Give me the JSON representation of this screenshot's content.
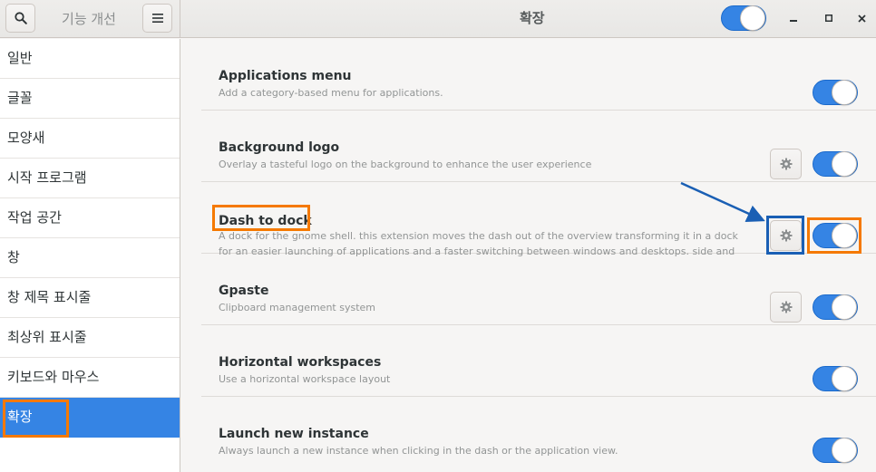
{
  "header": {
    "search_icon": "search-icon",
    "left_title": "기능 개선",
    "menu_icon": "hamburger-menu-icon",
    "title": "확장",
    "master_switch_on": true,
    "window_buttons": [
      "minimize-icon",
      "maximize-icon",
      "close-icon"
    ]
  },
  "sidebar": {
    "items": [
      {
        "label": "일반",
        "selected": false
      },
      {
        "label": "글꼴",
        "selected": false
      },
      {
        "label": "모양새",
        "selected": false
      },
      {
        "label": "시작 프로그램",
        "selected": false
      },
      {
        "label": "작업 공간",
        "selected": false
      },
      {
        "label": "창",
        "selected": false
      },
      {
        "label": "창 제목 표시줄",
        "selected": false
      },
      {
        "label": "최상위 표시줄",
        "selected": false
      },
      {
        "label": "키보드와 마우스",
        "selected": false
      },
      {
        "label": "확장",
        "selected": true
      }
    ]
  },
  "extensions": [
    {
      "name": "Applications menu",
      "description": "Add a category-based menu for applications.",
      "has_settings": false,
      "enabled": true
    },
    {
      "name": "Background logo",
      "description": "Overlay a tasteful logo on the background to enhance the user experience",
      "has_settings": true,
      "enabled": true
    },
    {
      "name": "Dash to dock",
      "description": "A dock for the gnome shell. this extension moves the dash out of the overview transforming it in a dock for an easier launching of applications and a faster switching between windows and desktops. side and botto…",
      "has_settings": true,
      "enabled": true
    },
    {
      "name": "Gpaste",
      "description": "Clipboard management system",
      "has_settings": true,
      "enabled": true
    },
    {
      "name": "Horizontal workspaces",
      "description": "Use a horizontal workspace layout",
      "has_settings": false,
      "enabled": true
    },
    {
      "name": "Launch new instance",
      "description": "Always launch a new instance when clicking in the dash or the application view.",
      "has_settings": false,
      "enabled": true
    }
  ],
  "colors": {
    "accent": "#3584e4",
    "highlight_orange": "#f57900",
    "highlight_blue": "#1a5fb4"
  }
}
